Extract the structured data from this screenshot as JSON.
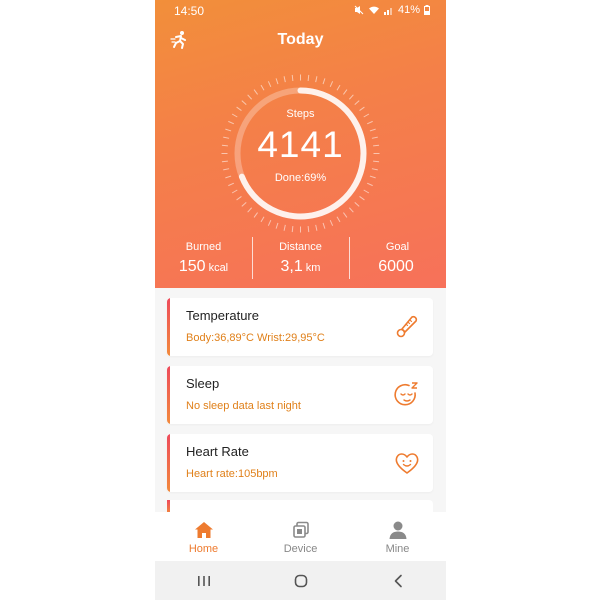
{
  "status_bar": {
    "time": "14:50",
    "battery": "41%",
    "icons": [
      "mute-icon",
      "wifi-icon",
      "signal-icon",
      "battery-icon"
    ]
  },
  "header": {
    "title": "Today",
    "app_icon": "runner-icon"
  },
  "steps": {
    "label": "Steps",
    "value": "4141",
    "done_text": "Done:69%",
    "progress": 0.69
  },
  "stats": [
    {
      "label": "Burned",
      "value": "150",
      "unit": "kcal"
    },
    {
      "label": "Distance",
      "value": "3,1",
      "unit": "km"
    },
    {
      "label": "Goal",
      "value": "6000",
      "unit": ""
    }
  ],
  "cards": [
    {
      "title": "Temperature",
      "subtitle": "Body:36,89°C  Wrist:29,95°C",
      "icon": "thermometer-icon"
    },
    {
      "title": "Sleep",
      "subtitle": "No sleep data last night",
      "icon": "sleep-face-icon"
    },
    {
      "title": "Heart Rate",
      "subtitle": "Heart rate:105bpm",
      "icon": "heart-face-icon"
    }
  ],
  "bottom_nav": [
    {
      "label": "Home",
      "icon": "home-icon",
      "active": true
    },
    {
      "label": "Device",
      "icon": "device-icon",
      "active": false
    },
    {
      "label": "Mine",
      "icon": "person-icon",
      "active": false
    }
  ],
  "colors": {
    "accent": "#ee7b2f",
    "hero_start": "#f28f3a",
    "hero_end": "#f7715a",
    "card_subtitle": "#e0801a",
    "card_bar_top": "#ee4a5b",
    "card_bar_bottom": "#f28a3c"
  }
}
